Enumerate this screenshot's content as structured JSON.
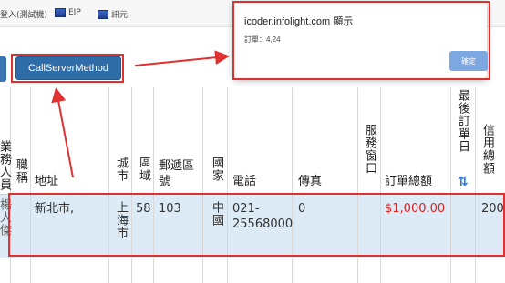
{
  "bookmarks": [
    {
      "icon": "page-icon",
      "label": "登入(測試機)"
    },
    {
      "icon": "page-icon",
      "label": "EIP"
    },
    {
      "icon": "page-icon",
      "label": "訊元"
    }
  ],
  "toolbar": {
    "call_label": "CallServerMethod"
  },
  "dialog": {
    "title": "icoder.infolight.com 顯示",
    "message": "訂單：4,24",
    "ok_label": "確定"
  },
  "table": {
    "headers": {
      "c0": "業務人員",
      "c1": "職稱",
      "c2": "地址",
      "c3": "城市",
      "c4": "區域",
      "c5": "郵遞區號",
      "c6": "國家",
      "c7": "電話",
      "c8": "傳真",
      "c9": "服務窗口",
      "c10": "訂單總額",
      "c11": "最後訂單日",
      "c12": "信用總額"
    },
    "sort_icon": "sort-arrows-icon",
    "row": {
      "c0": "楊人傑",
      "c1": "",
      "c2": "新北市,",
      "c3": "上海市",
      "c4": "58",
      "c5": "103",
      "c6": "中國",
      "c7": "021-25568000",
      "c8": "0",
      "c9": "",
      "c10": "$1,000.00",
      "c11": "",
      "c12": "200"
    }
  },
  "colors": {
    "accent": "#2f6da8",
    "row_selected": "#dcebf6",
    "amount_red": "#e02020",
    "annotation_red": "#e03030",
    "dialog_button": "#7da7e0"
  }
}
